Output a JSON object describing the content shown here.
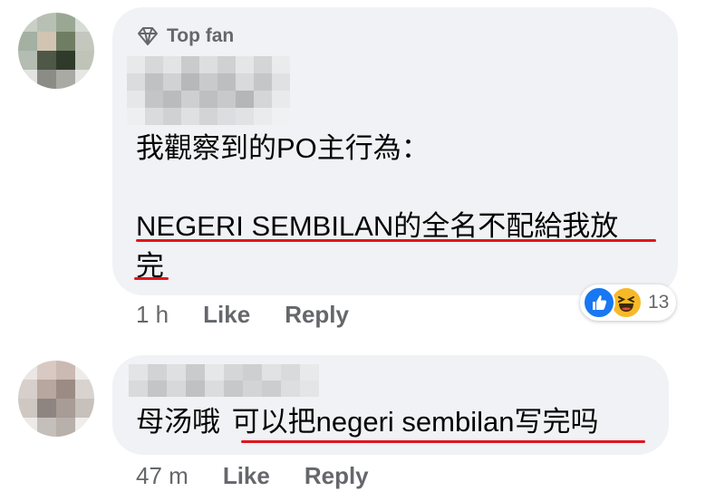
{
  "comments": [
    {
      "badge": "Top fan",
      "badge_icon": "diamond-icon",
      "text_line1": "我觀察到的PO主行為：",
      "text_line2": "NEGERI SEMBILAN的全名不配給我放",
      "text_line3": "完",
      "time": "1 h",
      "like_label": "Like",
      "reply_label": "Reply",
      "reactions": {
        "icons": [
          "like-icon",
          "haha-icon"
        ],
        "count": "13"
      }
    },
    {
      "text_prefix": "母汤哦",
      "text_highlight": "可以把negeri sembilan写完吗",
      "time": "47 m",
      "like_label": "Like",
      "reply_label": "Reply"
    }
  ],
  "colors": {
    "bubble": "#f0f2f5",
    "secondary_text": "#65676b",
    "underline": "#e0161d",
    "like_blue": "#1877f2",
    "haha_yellow": "#f7b928"
  }
}
